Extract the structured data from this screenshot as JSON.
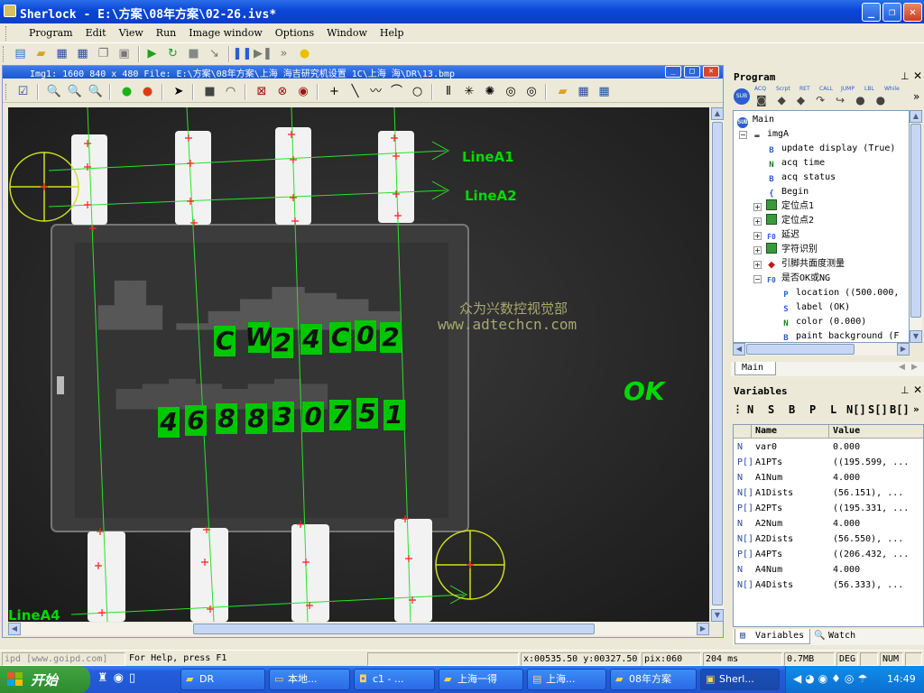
{
  "window": {
    "title": "Sherlock - E:\\方案\\08年方案\\02-26.ivs*"
  },
  "menu": [
    "Program",
    "Edit",
    "View",
    "Run",
    "Image window",
    "Options",
    "Window",
    "Help"
  ],
  "image_window": {
    "title": "Img1: 1600 840 x 480   File: E:\\方案\\08年方案\\上海   海吉研究机设置   1C\\上海   海\\DR\\13.bmp"
  },
  "image": {
    "line_labels": [
      "LineA1",
      "LineA2",
      "LineA4"
    ],
    "watermark_cn": "众为兴数控视觉部",
    "watermark_url": "www.adtechcn.com",
    "chip_text_top": [
      "C",
      "W",
      "2",
      "4",
      "C",
      "0",
      "2"
    ],
    "chip_text_bottom": [
      "4",
      "6",
      "8",
      "8",
      "3",
      "0",
      "7",
      "5",
      "1"
    ],
    "result": "OK"
  },
  "program_panel": {
    "title": "Program",
    "tools": [
      "SUB",
      "ACQ",
      "Scrpt",
      "RET",
      "CALL",
      "JUMP",
      "LBL",
      "While"
    ],
    "tree": [
      {
        "label": "Main",
        "level": 0,
        "icon": "SUB"
      },
      {
        "label": "imgA",
        "level": 1,
        "icon": "img",
        "expander": "−"
      },
      {
        "label": "update display (True)",
        "level": 2,
        "icon": "B"
      },
      {
        "label": "acq time",
        "level": 2,
        "icon": "N"
      },
      {
        "label": "acq status",
        "level": 2,
        "icon": "B"
      },
      {
        "label": "Begin",
        "level": 2,
        "icon": "{"
      },
      {
        "label": "定位点1",
        "level": 2,
        "icon": "grid",
        "expander": "+"
      },
      {
        "label": "定位点2",
        "level": 2,
        "icon": "grid",
        "expander": "+"
      },
      {
        "label": "延迟",
        "level": 2,
        "icon": "F0",
        "expander": "+"
      },
      {
        "label": "字符识别",
        "level": 2,
        "icon": "grid",
        "expander": "+"
      },
      {
        "label": "引脚共面度测量",
        "level": 2,
        "icon": "diamond",
        "expander": "+"
      },
      {
        "label": "是否OK或NG",
        "level": 2,
        "icon": "F0",
        "expander": "−"
      },
      {
        "label": "location ((500.000,",
        "level": 3,
        "icon": "P"
      },
      {
        "label": "label (OK)",
        "level": 3,
        "icon": "S"
      },
      {
        "label": "color (0.000)",
        "level": 3,
        "icon": "N"
      },
      {
        "label": "paint background (F",
        "level": 3,
        "icon": "B"
      }
    ],
    "tab": "Main"
  },
  "variables_panel": {
    "title": "Variables",
    "type_buttons": [
      "N",
      "S",
      "B",
      "P",
      "L",
      "N[]",
      "S[]",
      "B[]"
    ],
    "columns": [
      "Name",
      "Value"
    ],
    "rows": [
      {
        "type": "N",
        "name": "var0",
        "value": "0.000"
      },
      {
        "type": "P[]",
        "name": "A1PTs",
        "value": "((195.599, ..."
      },
      {
        "type": "N",
        "name": "A1Num",
        "value": "4.000"
      },
      {
        "type": "N[]",
        "name": "A1Dists",
        "value": "(56.151), ..."
      },
      {
        "type": "P[]",
        "name": "A2PTs",
        "value": "((195.331, ..."
      },
      {
        "type": "N",
        "name": "A2Num",
        "value": "4.000"
      },
      {
        "type": "N[]",
        "name": "A2Dists",
        "value": "(56.550), ..."
      },
      {
        "type": "P[]",
        "name": "A4PTs",
        "value": "((206.432, ..."
      },
      {
        "type": "N",
        "name": "A4Num",
        "value": "4.000"
      },
      {
        "type": "N[]",
        "name": "A4Dists",
        "value": "(56.333), ..."
      }
    ],
    "tabs": [
      "Variables",
      "Watch"
    ]
  },
  "statusbar": {
    "left": "ipd [www.goipd.com]",
    "help": "For Help, press F1",
    "coords": "x:00535.50 y:00327.50",
    "pix": "pix:060",
    "time": "204 ms",
    "mem": "0.7MB",
    "deg": "DEG",
    "num": "NUM"
  },
  "taskbar": {
    "start": "开始",
    "tasks": [
      "DR",
      "本地...",
      "c1 - ...",
      "上海一得",
      "上海...",
      "08年方案",
      "Sherl..."
    ],
    "clock": "14:49"
  }
}
